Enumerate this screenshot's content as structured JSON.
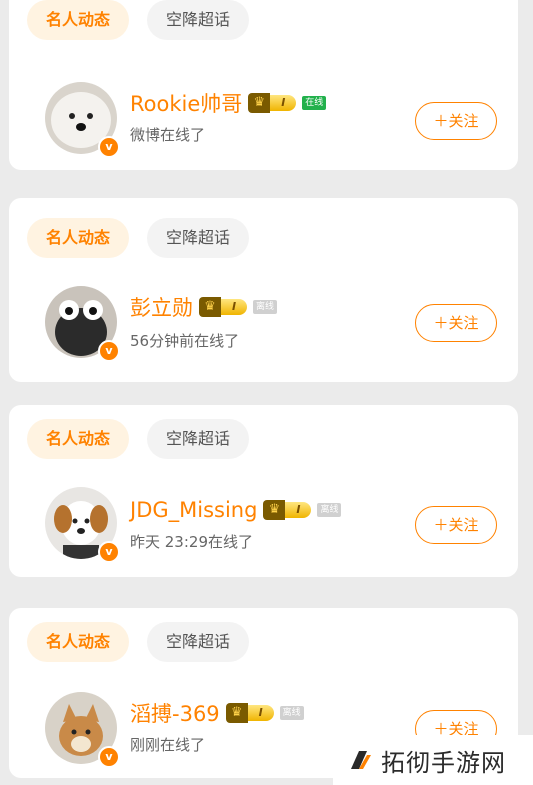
{
  "tabs": {
    "active": "名人动态",
    "inactive": "空降超话"
  },
  "follow_label": "＋关注",
  "cards": [
    {
      "name": "Rookie帅哥",
      "level": "I",
      "status": "在线",
      "status_type": "online",
      "sub": "微博在线了"
    },
    {
      "name": "彭立勋",
      "level": "I",
      "status": "离线",
      "status_type": "offline",
      "sub": "56分钟前在线了"
    },
    {
      "name": "JDG_Missing",
      "level": "I",
      "status": "离线",
      "status_type": "offline",
      "sub": "昨天 23:29在线了"
    },
    {
      "name": "滔搏-369",
      "level": "I",
      "status": "离线",
      "status_type": "offline",
      "sub": "刚刚在线了"
    }
  ],
  "watermark": {
    "text": "拓彻手游网"
  },
  "colors": {
    "accent": "#ff8200",
    "online": "#22b14c",
    "background": "#ebebeb"
  }
}
